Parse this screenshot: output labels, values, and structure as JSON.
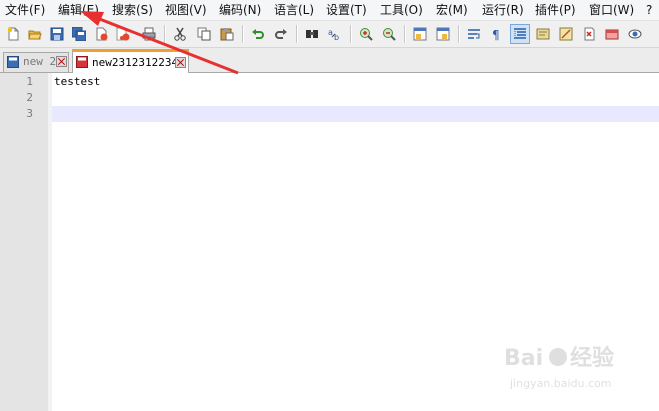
{
  "menu": [
    "文件(F)",
    "编辑(E)",
    "搜索(S)",
    "视图(V)",
    "编码(N)",
    "语言(L)",
    "设置(T)",
    "工具(O)",
    "宏(M)",
    "运行(R)",
    "插件(P)",
    "窗口(W)",
    "?"
  ],
  "toolbar_icons": [
    "new-file-icon",
    "open-file-icon",
    "save-icon",
    "save-all-icon",
    "close-icon",
    "close-all-icon",
    "print-icon",
    "cut-icon",
    "copy-icon",
    "paste-icon",
    "undo-icon",
    "redo-icon",
    "find-icon",
    "replace-icon",
    "zoom-in-icon",
    "zoom-out-icon",
    "sync-vertical-icon",
    "sync-horizontal-icon",
    "word-wrap-icon",
    "show-all-chars-icon",
    "indent-guide-icon",
    "doc-map-icon",
    "function-list-icon",
    "folder-workspace-icon",
    "monitoring-icon",
    "macro-record-icon"
  ],
  "tabs": [
    {
      "label": "new 2",
      "active": false
    },
    {
      "label": "new2312312234",
      "active": true
    }
  ],
  "editor": {
    "line_numbers": [
      "1",
      "2",
      "3"
    ],
    "lines": [
      "testest",
      "",
      ""
    ],
    "current_line": 3
  },
  "watermark": {
    "brand": "Baidu",
    "cn": "经验",
    "url": "jingyan.baidu.com"
  },
  "colors": {
    "accent_tab": "#f0a030",
    "current_line": "#e8e8ff",
    "annotation_arrow": "#e83030"
  }
}
